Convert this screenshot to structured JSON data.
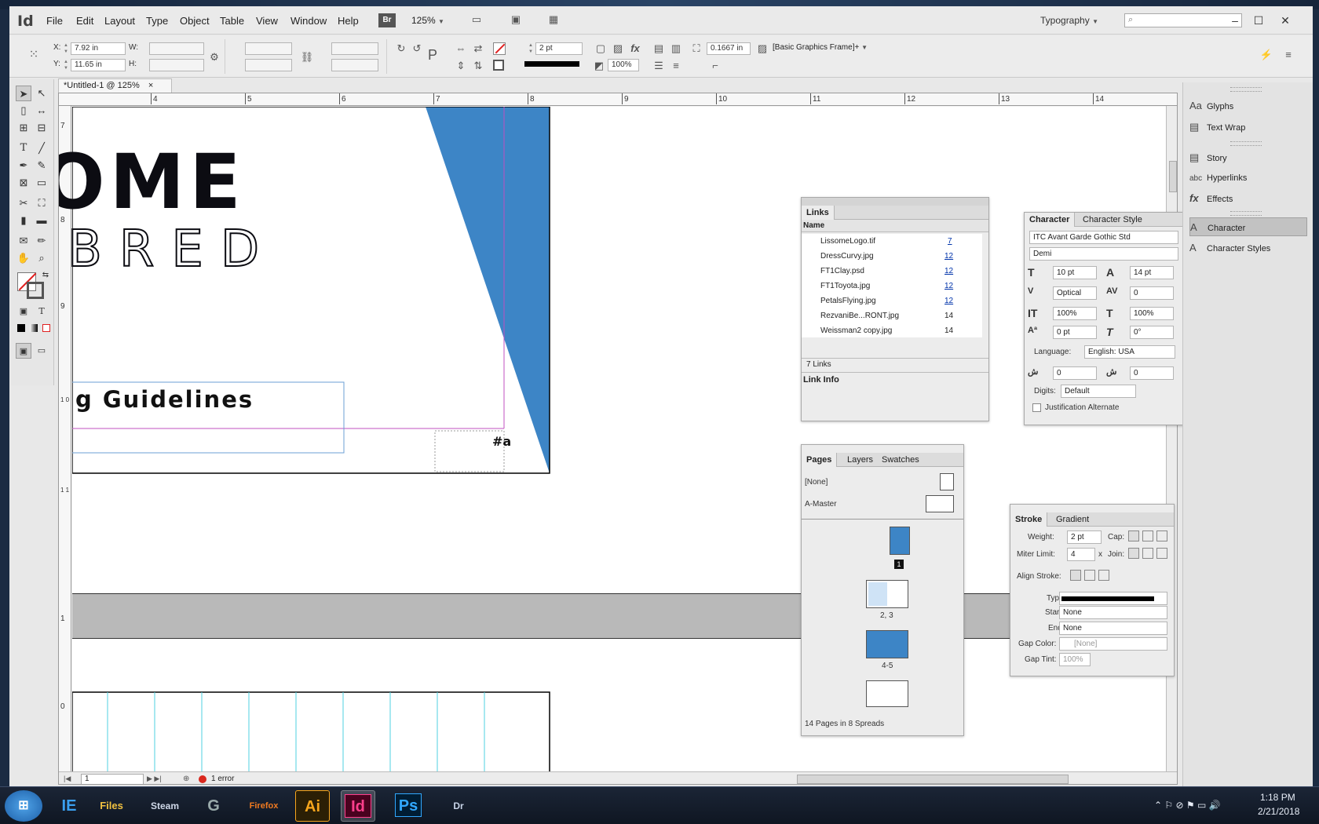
{
  "app": {
    "logo": "Id",
    "menu": [
      "File",
      "Edit",
      "Layout",
      "Type",
      "Object",
      "Table",
      "View",
      "Window",
      "Help"
    ],
    "bridge": "Br",
    "zoom": "125%",
    "workspace": "Typography",
    "window_controls": [
      "–",
      "☐",
      "✕"
    ]
  },
  "control_bar": {
    "x_label": "X:",
    "x_value": "7.92 in",
    "y_label": "Y:",
    "y_value": "11.65 in",
    "w_label": "W:",
    "h_label": "H:",
    "stroke_weight": "2 pt",
    "opacity": "100%",
    "fit_value": "0.1667 in",
    "object_style": "[Basic Graphics Frame]+"
  },
  "document": {
    "tab_title": "*Untitled-1 @ 125%",
    "tab_close": "×",
    "ruler_h": [
      "4",
      "5",
      "6",
      "7",
      "8",
      "9",
      "10",
      "11",
      "12",
      "13",
      "14"
    ],
    "ruler_v": [
      "7",
      "8",
      "9",
      "1 0",
      "1 1",
      "1",
      "0"
    ],
    "logo_line1": "OME",
    "logo_line2": "BRED",
    "heading": "g Guidelines",
    "page_marker": "#a",
    "accent_blue": "#3d85c6"
  },
  "status": {
    "page": "1",
    "errors": "1 error"
  },
  "links_panel": {
    "title": "Links",
    "col_name": "Name",
    "items": [
      {
        "name": "LissomeLogo.tif",
        "page": "7",
        "link": true
      },
      {
        "name": "DressCurvy.jpg",
        "page": "12",
        "link": true
      },
      {
        "name": "FT1Clay.psd",
        "page": "12",
        "link": true
      },
      {
        "name": "FT1Toyota.jpg",
        "page": "12",
        "link": true
      },
      {
        "name": "PetalsFlying.jpg",
        "page": "12",
        "link": true
      },
      {
        "name": "RezvaniBe...RONT.jpg",
        "page": "14",
        "link": false
      },
      {
        "name": "Weissman2 copy.jpg",
        "page": "14",
        "link": false
      }
    ],
    "count": "7 Links",
    "link_info": "Link Info"
  },
  "character_panel": {
    "tab1": "Character",
    "tab2": "Character Style",
    "font": "ITC Avant Garde Gothic Std",
    "style": "Demi",
    "size": "10 pt",
    "leading": "14 pt",
    "kerning": "Optical",
    "tracking": "0",
    "vscale": "100%",
    "hscale": "100%",
    "baseline": "0 pt",
    "skew": "0°",
    "language_label": "Language:",
    "language": "English: USA",
    "rtl1": "0",
    "rtl2": "0",
    "digits_label": "Digits:",
    "digits": "Default",
    "justification": "Justification Alternate"
  },
  "pages_panel": {
    "tabs": [
      "Pages",
      "Layers",
      "Swatches"
    ],
    "none": "[None]",
    "master": "A-Master",
    "page_labels": [
      "1",
      "2, 3",
      "4-5"
    ],
    "summary": "14 Pages in 8 Spreads"
  },
  "stroke_panel": {
    "tab1": "Stroke",
    "tab2": "Gradient",
    "weight_label": "Weight:",
    "weight": "2 pt",
    "cap_label": "Cap:",
    "miter_label": "Miter Limit:",
    "miter": "4",
    "miter_x": "x",
    "join_label": "Join:",
    "align_label": "Align Stroke:",
    "type_label": "Type:",
    "start_label": "Start:",
    "start": "None",
    "end_label": "End:",
    "end": "None",
    "gap_color_label": "Gap Color:",
    "gap_color": "[None]",
    "gap_tint_label": "Gap Tint:",
    "gap_tint": "100%"
  },
  "dock": {
    "items": [
      {
        "icon": "Aa",
        "label": "Glyphs"
      },
      {
        "icon": "▤",
        "label": "Text Wrap"
      },
      {
        "icon": "▤",
        "label": "Story"
      },
      {
        "icon": "abc",
        "label": "Hyperlinks"
      },
      {
        "icon": "fx",
        "label": "Effects"
      },
      {
        "icon": "A",
        "label": "Character"
      },
      {
        "icon": "A",
        "label": "Character Styles"
      }
    ]
  },
  "taskbar": {
    "apps": [
      "IE",
      "Files",
      "Steam",
      "G",
      "Firefox",
      "Ai",
      "Id",
      "Ps",
      "Dr"
    ],
    "time": "1:18 PM",
    "date": "2/21/2018"
  }
}
